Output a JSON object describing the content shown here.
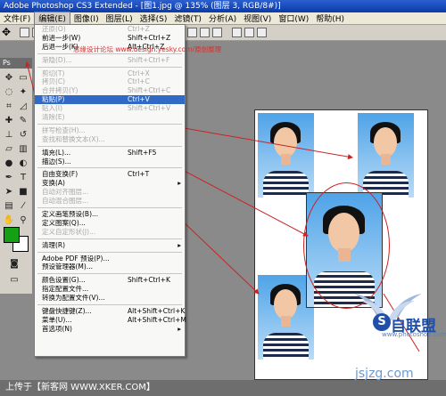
{
  "title": "Adobe Photoshop CS3 Extended - [图1.jpg @ 135% (图层 3, RGB/8#)]",
  "menu": [
    "文件(F)",
    "编辑(E)",
    "图像(I)",
    "图层(L)",
    "选择(S)",
    "滤镜(T)",
    "分析(A)",
    "视图(V)",
    "窗口(W)",
    "帮助(H)"
  ],
  "toolbox_header": "Ps",
  "watermark_text": "思缘设计论坛 www.design.yesky.com/原创整理",
  "edit_menu": [
    {
      "label": "还原(O)",
      "shortcut": "Ctrl+Z",
      "state": "disabled"
    },
    {
      "label": "前进一步(W)",
      "shortcut": "Shift+Ctrl+Z",
      "state": "normal"
    },
    {
      "label": "后退一步(K)",
      "shortcut": "Alt+Ctrl+Z",
      "state": "normal"
    },
    {
      "sep": true
    },
    {
      "label": "渐隐(D)...",
      "shortcut": "Shift+Ctrl+F",
      "state": "disabled"
    },
    {
      "sep": true
    },
    {
      "label": "剪切(T)",
      "shortcut": "Ctrl+X",
      "state": "disabled"
    },
    {
      "label": "拷贝(C)",
      "shortcut": "Ctrl+C",
      "state": "disabled"
    },
    {
      "label": "合并拷贝(Y)",
      "shortcut": "Shift+Ctrl+C",
      "state": "disabled"
    },
    {
      "label": "粘贴(P)",
      "shortcut": "Ctrl+V",
      "state": "highlight"
    },
    {
      "label": "贴入(I)",
      "shortcut": "Shift+Ctrl+V",
      "state": "disabled"
    },
    {
      "label": "清除(E)",
      "shortcut": "",
      "state": "disabled"
    },
    {
      "sep": true
    },
    {
      "label": "拼写检查(H)...",
      "shortcut": "",
      "state": "disabled"
    },
    {
      "label": "查找和替换文本(X)...",
      "shortcut": "",
      "state": "disabled"
    },
    {
      "sep": true
    },
    {
      "label": "填充(L)...",
      "shortcut": "Shift+F5",
      "state": "normal"
    },
    {
      "label": "描边(S)...",
      "shortcut": "",
      "state": "normal"
    },
    {
      "sep": true
    },
    {
      "label": "自由变换(F)",
      "shortcut": "Ctrl+T",
      "state": "normal"
    },
    {
      "label": "变换(A)",
      "shortcut": "",
      "state": "normal",
      "submenu": true
    },
    {
      "label": "自动对齐图层...",
      "shortcut": "",
      "state": "disabled"
    },
    {
      "label": "自动混合图层...",
      "shortcut": "",
      "state": "disabled"
    },
    {
      "sep": true
    },
    {
      "label": "定义画笔预设(B)...",
      "shortcut": "",
      "state": "normal"
    },
    {
      "label": "定义图案(Q)...",
      "shortcut": "",
      "state": "normal"
    },
    {
      "label": "定义自定形状(J)...",
      "shortcut": "",
      "state": "disabled"
    },
    {
      "sep": true
    },
    {
      "label": "清理(R)",
      "shortcut": "",
      "state": "normal",
      "submenu": true
    },
    {
      "sep": true
    },
    {
      "label": "Adobe PDF 预设(P)...",
      "shortcut": "",
      "state": "normal"
    },
    {
      "label": "预设管理器(M)...",
      "shortcut": "",
      "state": "normal"
    },
    {
      "sep": true
    },
    {
      "label": "颜色设置(G)...",
      "shortcut": "Shift+Ctrl+K",
      "state": "normal"
    },
    {
      "label": "指定配置文件...",
      "shortcut": "",
      "state": "normal"
    },
    {
      "label": "转换为配置文件(V)...",
      "shortcut": "",
      "state": "normal"
    },
    {
      "sep": true
    },
    {
      "label": "键盘快捷键(Z)...",
      "shortcut": "Alt+Shift+Ctrl+K",
      "state": "normal"
    },
    {
      "label": "菜单(U)...",
      "shortcut": "Alt+Shift+Ctrl+M",
      "state": "normal"
    },
    {
      "label": "首选项(N)",
      "shortcut": "",
      "state": "normal",
      "submenu": true
    }
  ],
  "status_text": "上传于【新客网 WWW.XKER.COM】",
  "logo_text": "自联盟",
  "logo_letter": "S",
  "logo_url": "www.photoshop.com",
  "site_mark": "jsjzg.com",
  "colors": {
    "foreground": "#14a014",
    "background": "#ffffff",
    "highlight": "#316ac5",
    "arrow": "#cc2222"
  }
}
